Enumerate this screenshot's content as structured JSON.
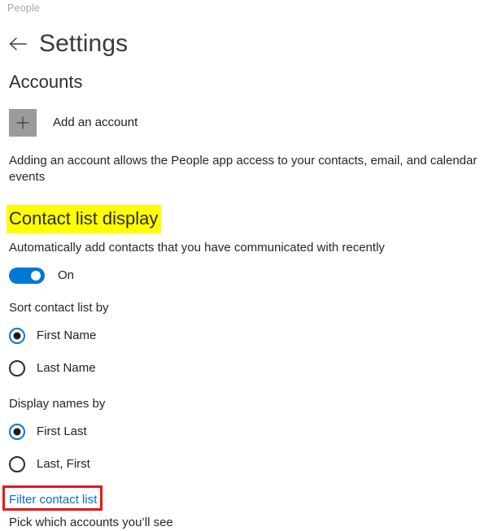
{
  "app": {
    "name": "People"
  },
  "header": {
    "back_icon": "back-arrow-icon",
    "title": "Settings"
  },
  "accounts": {
    "heading": "Accounts",
    "add_account_icon": "plus-icon",
    "add_account_label": "Add an account",
    "description": "Adding an account allows the People app access to your contacts, email, and calendar events"
  },
  "contact_list_display": {
    "heading": "Contact list display",
    "heading_highlight_color": "#ffff00",
    "auto_add": {
      "description": "Automatically add contacts that you have communicated with recently",
      "toggle_state": "On",
      "toggle_on_color": "#0078d7"
    },
    "sort_by": {
      "label": "Sort contact list by",
      "options": [
        {
          "label": "First Name",
          "selected": true
        },
        {
          "label": "Last Name",
          "selected": false
        }
      ]
    },
    "display_names_by": {
      "label": "Display names by",
      "options": [
        {
          "label": "First Last",
          "selected": true
        },
        {
          "label": "Last, First",
          "selected": false
        }
      ]
    },
    "filter": {
      "link_label": "Filter contact list",
      "link_color": "#0a6cc4",
      "highlight_box_color": "#e81717",
      "description": "Pick which accounts you’ll see"
    }
  }
}
